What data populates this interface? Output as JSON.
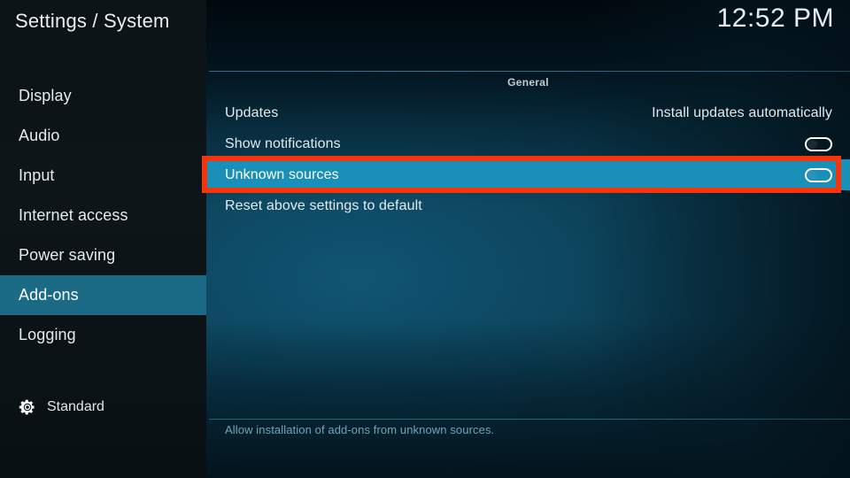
{
  "window": {
    "title": "Settings / System",
    "clock": "12:52 PM"
  },
  "sidebar": {
    "items": [
      {
        "label": "Display",
        "selected": false
      },
      {
        "label": "Audio",
        "selected": false
      },
      {
        "label": "Input",
        "selected": false
      },
      {
        "label": "Internet access",
        "selected": false
      },
      {
        "label": "Power saving",
        "selected": false
      },
      {
        "label": "Add-ons",
        "selected": true
      },
      {
        "label": "Logging",
        "selected": false
      }
    ],
    "profile": {
      "icon": "gear-icon",
      "label": "Standard"
    }
  },
  "main": {
    "group_header": "General",
    "rows": [
      {
        "label": "Updates",
        "control": "value",
        "value": "Install updates automatically",
        "focused": false
      },
      {
        "label": "Show notifications",
        "control": "toggle",
        "toggle_state": "off",
        "focused": false
      },
      {
        "label": "Unknown sources",
        "control": "toggle",
        "toggle_state": "off",
        "focused": true
      },
      {
        "label": "Reset above settings to default",
        "control": "none",
        "focused": false
      }
    ],
    "description": "Allow installation of add-ons from unknown sources."
  },
  "annotation": {
    "color": "#f8340d",
    "target": "Unknown sources"
  },
  "colors": {
    "accent": "#1a90b8",
    "sidebar_selected": "#1b6b87",
    "annotation": "#f8340d",
    "description_text": "#6fa6b8"
  }
}
